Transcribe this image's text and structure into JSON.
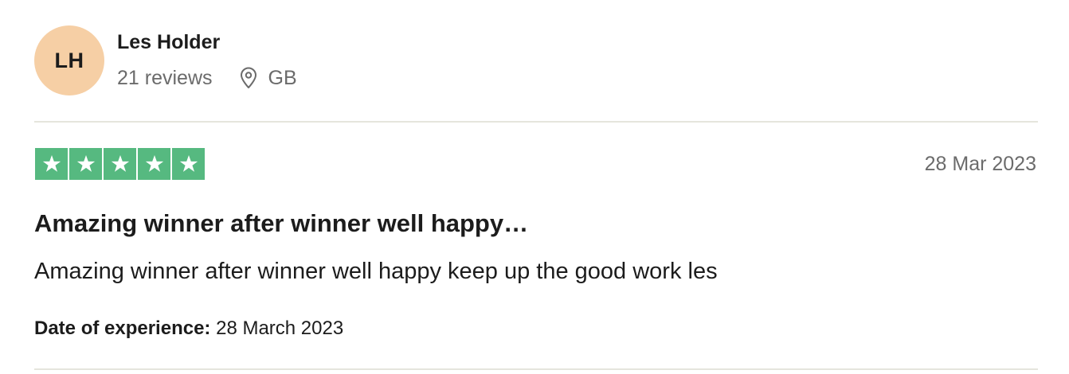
{
  "consumer": {
    "initials": "LH",
    "avatar_color": "#f6cfa5",
    "name": "Les Holder",
    "reviews_count": "21 reviews",
    "location_icon": "location-pin-icon",
    "country": "GB"
  },
  "rating": {
    "stars": 5,
    "max_stars": 5,
    "star_color": "#56b980",
    "star_icon": "star-icon"
  },
  "review": {
    "date": "28 Mar 2023",
    "title": "Amazing winner after winner well happy…",
    "body": "Amazing winner after winner well happy keep up the good work les",
    "experience_label": "Date of experience:",
    "experience_date": "28 March 2023"
  },
  "colors": {
    "text_primary": "#1c1c1c",
    "text_secondary": "#6b6b6b",
    "divider": "#e5e5dd"
  }
}
